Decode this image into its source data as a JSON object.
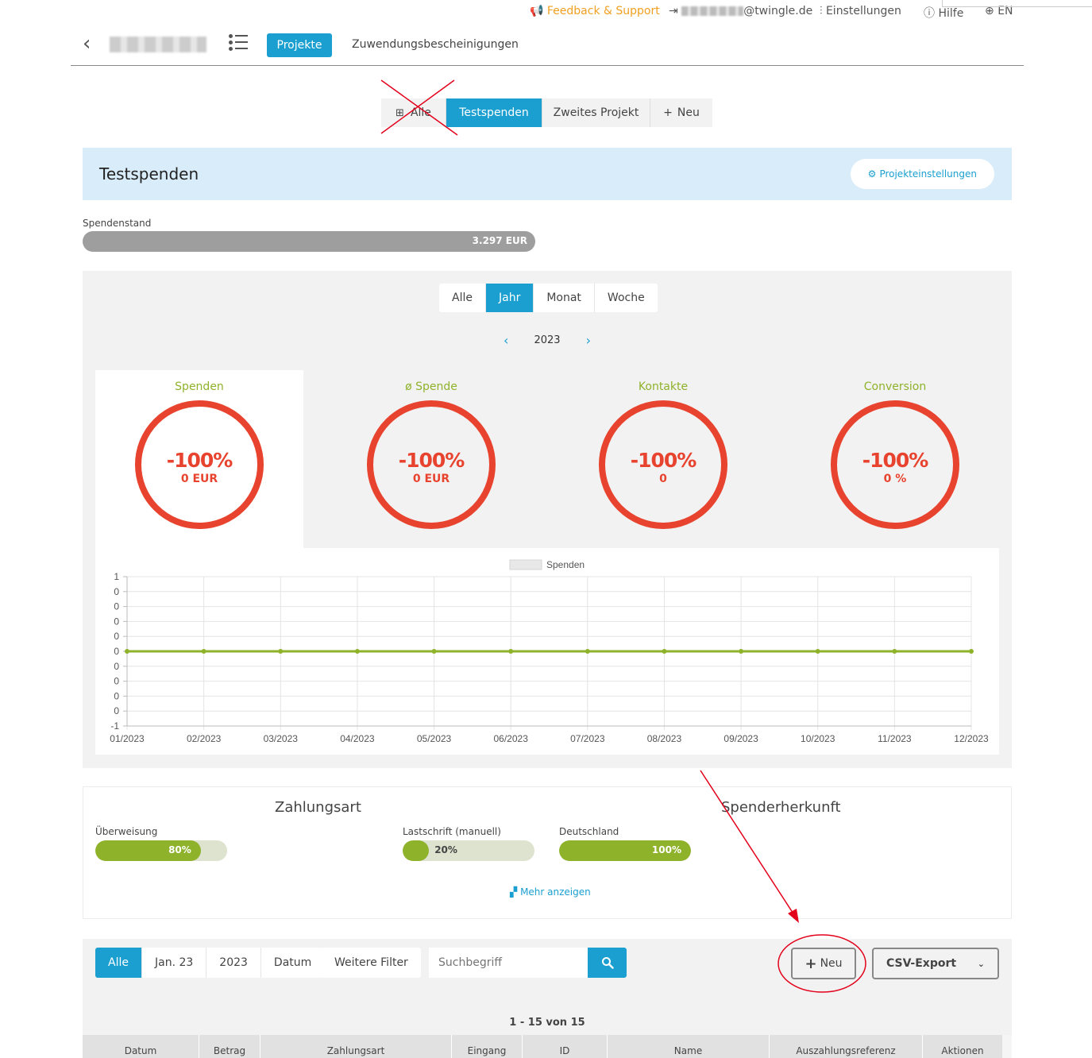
{
  "topbar": {
    "feedback": "Feedback & Support",
    "user": "@twingle.de",
    "settings": "Einstellungen",
    "help": "Hilfe",
    "lang": "EN"
  },
  "header": {
    "nav_projects": "Projekte",
    "nav_receipts": "Zuwendungsbescheinigungen"
  },
  "project_tabs": {
    "all": "Alle",
    "items": [
      "Testspenden",
      "Zweites Projekt"
    ],
    "new": "Neu"
  },
  "project": {
    "title": "Testspenden",
    "settings_label": "Projekteinstellungen"
  },
  "donation_status": {
    "label": "Spendenstand",
    "value": "3.297 EUR"
  },
  "period_tabs": [
    "Alle",
    "Jahr",
    "Monat",
    "Woche"
  ],
  "period_active": "Jahr",
  "year": "2023",
  "kpis": [
    {
      "label": "Spenden",
      "percent": "-100%",
      "value": "0 EUR"
    },
    {
      "label": "ø Spende",
      "percent": "-100%",
      "value": "0 EUR"
    },
    {
      "label": "Kontakte",
      "percent": "-100%",
      "value": "0"
    },
    {
      "label": "Conversion",
      "percent": "-100%",
      "value": "0 %"
    }
  ],
  "chart_data": {
    "type": "line",
    "legend": "Spenden",
    "categories": [
      "01/2023",
      "02/2023",
      "03/2023",
      "04/2023",
      "05/2023",
      "06/2023",
      "07/2023",
      "08/2023",
      "09/2023",
      "10/2023",
      "11/2023",
      "12/2023"
    ],
    "values": [
      0,
      0,
      0,
      0,
      0,
      0,
      0,
      0,
      0,
      0,
      0,
      0
    ],
    "y_tick_labels": [
      "1",
      "0",
      "0",
      "0",
      "0",
      "0",
      "0",
      "0",
      "0",
      "0",
      "-1"
    ],
    "ylim": [
      -1,
      1
    ],
    "grid": true,
    "line_color": "#8fb22b"
  },
  "payment": {
    "title_payment": "Zahlungsart",
    "title_origin": "Spenderherkunft",
    "bars": [
      {
        "label": "Überweisung",
        "value": 80,
        "text": "80%"
      },
      {
        "label": "Lastschrift (manuell)",
        "value": 20,
        "text": "20%"
      },
      {
        "label": "Deutschland",
        "value": 100,
        "text": "100%"
      }
    ],
    "more": "Mehr anzeigen"
  },
  "filters": {
    "tabs": [
      "Alle",
      "Jan. 23",
      "2023",
      "Datum"
    ],
    "more_filters": "Weitere Filter",
    "search_placeholder": "Suchbegriff",
    "new_button": "Neu",
    "export": "CSV-Export"
  },
  "table": {
    "count": "1 - 15 von 15",
    "columns": [
      "Datum",
      "Betrag",
      "Zahlungsart",
      "Eingang",
      "ID",
      "Name",
      "Auszahlungsreferenz",
      "Aktionen"
    ]
  },
  "colors": {
    "accent": "#1a9fd0",
    "negative": "#e8432e",
    "positive": "#8fb22b",
    "annotation": "#e3001b"
  }
}
